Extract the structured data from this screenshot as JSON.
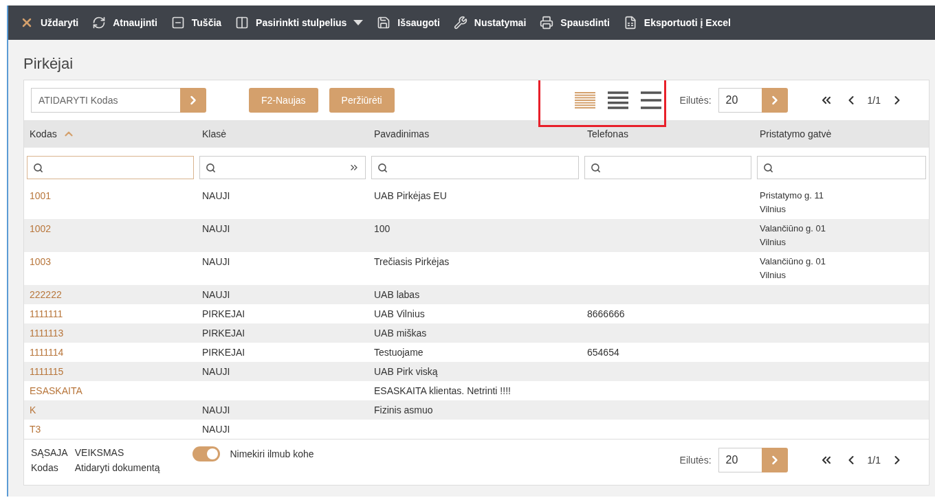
{
  "toolbar": [
    {
      "label": "Uždaryti"
    },
    {
      "label": "Atnaujinti"
    },
    {
      "label": "Tuščia"
    },
    {
      "label": "Pasirinkti stulpelius"
    },
    {
      "label": "Išsaugoti"
    },
    {
      "label": "Nustatymai"
    },
    {
      "label": "Spausdinti"
    },
    {
      "label": "Eksportuoti į Excel"
    }
  ],
  "title": "Pirkėjai",
  "open_field": {
    "placeholder": "ATIDARYTI Kodas"
  },
  "buttons": [
    "F2-Naujas",
    "Peržiūrėti"
  ],
  "density": [
    {
      "selected": true
    },
    {
      "selected": false
    },
    {
      "selected": false
    }
  ],
  "top_pager": {
    "rows_label": "Eilutės:",
    "rows_value": "20",
    "page": "1/1"
  },
  "table": {
    "columns": [
      {
        "label": "Kodas",
        "sorted": true
      },
      {
        "label": "Klasė",
        "sorted": false
      },
      {
        "label": "Pavadinimas",
        "sorted": false
      },
      {
        "label": "Telefonas",
        "sorted": false
      },
      {
        "label": "Pristatymo gatvė",
        "sorted": false
      }
    ],
    "rows": [
      {
        "code": "1001",
        "class": "NAUJI",
        "name": "UAB Pirkėjas EU",
        "phone": "",
        "street": [
          "Pristatymo g. 11",
          "Vilnius"
        ]
      },
      {
        "code": "1002",
        "class": "NAUJI",
        "name": "100",
        "phone": "",
        "street": [
          "Valančiūno g. 01",
          "Vilnius"
        ]
      },
      {
        "code": "1003",
        "class": "NAUJI",
        "name": "Trečiasis Pirkėjas",
        "phone": "",
        "street": [
          "Valančiūno g. 01",
          "Vilnius"
        ]
      },
      {
        "code": "222222",
        "class": "NAUJI",
        "name": "UAB labas",
        "phone": "",
        "street": []
      },
      {
        "code": "1111111",
        "class": "PIRKEJAI",
        "name": "UAB Vilnius",
        "phone": "8666666",
        "street": []
      },
      {
        "code": "1111113",
        "class": "PIRKEJAI",
        "name": "UAB miškas",
        "phone": "",
        "street": []
      },
      {
        "code": "1111114",
        "class": "PIRKEJAI",
        "name": "Testuojame",
        "phone": "654654",
        "street": []
      },
      {
        "code": "1111115",
        "class": "NAUJI",
        "name": "UAB Pirk viską",
        "phone": "",
        "street": []
      },
      {
        "code": "ESASKAITA",
        "class": "",
        "name": "ESASKAITA klientas. Netrinti !!!!",
        "phone": "",
        "street": []
      },
      {
        "code": "K",
        "class": "NAUJI",
        "name": "Fizinis asmuo",
        "phone": "",
        "street": []
      },
      {
        "code": "T3",
        "class": "NAUJI",
        "name": "",
        "phone": "",
        "street": []
      }
    ]
  },
  "legend": [
    {
      "key": "SĄSAJA",
      "value": "Kodas"
    },
    {
      "key": "VEIKSMAS",
      "value": "Atidaryti dokumentą"
    }
  ],
  "toggle": {
    "label": "Nimekiri ilmub kohe",
    "on": true
  },
  "bottom_pager": {
    "rows_label": "Eilutės:",
    "rows_value": "20",
    "page": "1/1"
  }
}
